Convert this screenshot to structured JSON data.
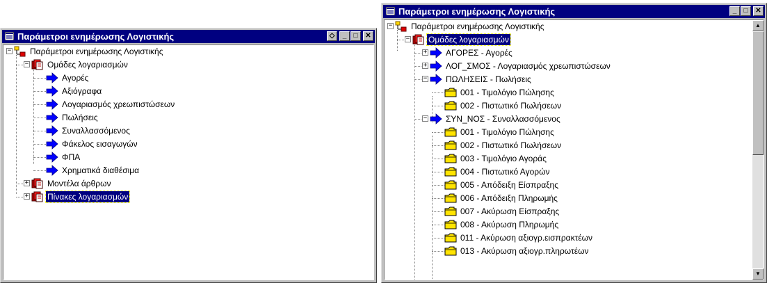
{
  "left_window": {
    "title": "Παράμετροι ενημέρωσης Λογιστικής",
    "tree": {
      "root": "Παράμετροι ενημέρωσης Λογιστικής",
      "groups_label": "Ομάδες λογαριασμών",
      "groups": [
        "Αγορές",
        "Αξιόγραφα",
        "Λογαριασμός χρεωπιστώσεων",
        "Πωλήσεις",
        "Συναλλασσόμενος",
        "Φάκελος εισαγωγών",
        "ΦΠΑ",
        "Χρηματικά διαθέσιμα"
      ],
      "models_label": "Μοντέλα άρθρων",
      "tables_label": "Πίνακες λογαριασμών"
    }
  },
  "right_window": {
    "title": "Παράμετροι ενημέρωσης Λογιστικής",
    "tree": {
      "root": "Παράμετροι ενημέρωσης Λογιστικής",
      "groups_label": "Ομάδες λογαριασμών",
      "agores": "ΑΓΟΡΕΣ - Αγορές",
      "log_smos": "ΛΟΓ_ΣΜΟΣ - Λογαριασμός χρεωπιστώσεων",
      "poliseis": "ΠΩΛΗΣΕΙΣ - Πωλήσεις",
      "poliseis_children": [
        "001 - Τιμολόγιο Πώλησης",
        "002 - Πιστωτικό Πωλήσεων"
      ],
      "syn_nos": "ΣΥΝ_ΝΟΣ - Συναλλασσόμενος",
      "syn_children": [
        "001 - Τιμολόγιο Πώλησης",
        "002 - Πιστωτικό Πωλήσεων",
        "003 - Τιμολόγιο Αγοράς",
        "004 - Πιστωτικό Αγορών",
        "005 - Απόδειξη Είσπραξης",
        "006 - Απόδειξη Πληρωμής",
        "007 - Ακύρωση Είσπραξης",
        "008 - Ακύρωση Πληρωμής",
        "011 - Ακύρωση αξιογρ.εισπρακτέων",
        "013 - Ακύρωση αξιογρ.πληρωτέων"
      ]
    }
  },
  "icons": {
    "window": "window-app-icon",
    "root": "org-tree-icon",
    "group": "document-group-icon",
    "item": "blue-arrow-icon",
    "child": "yellow-folder-icon",
    "expand": "plus-expander",
    "collapse": "minus-expander"
  },
  "colors": {
    "titlebar": "#000080",
    "selection": "#000080",
    "chrome": "#c0c0c0"
  }
}
